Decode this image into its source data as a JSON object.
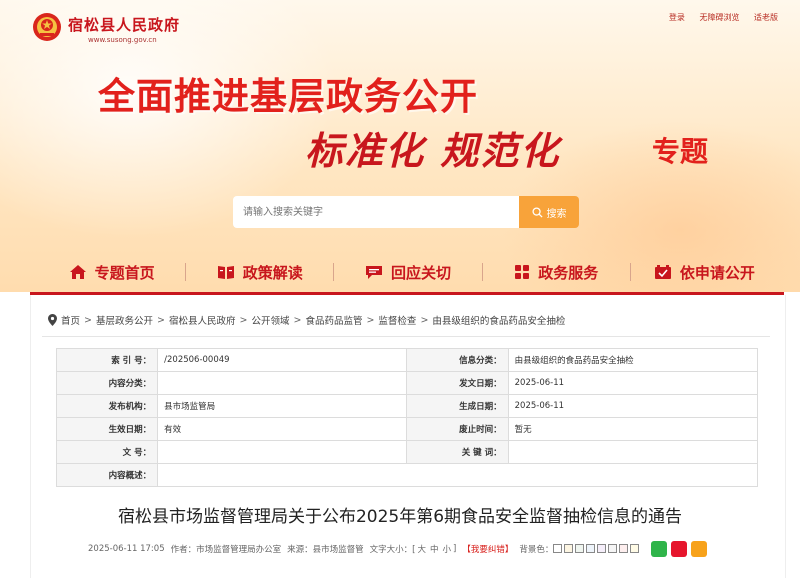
{
  "header": {
    "site_name": "宿松县人民政府",
    "site_url": "www.susong.gov.cn",
    "top_links": [
      "登录",
      "无障碍浏览",
      "适老版"
    ]
  },
  "banner": {
    "line1": "全面推进基层政务公开",
    "line2": "标准化 规范化",
    "line3": "专题"
  },
  "search": {
    "placeholder": "请输入搜索关键字",
    "button_label": "搜索"
  },
  "nav": [
    {
      "label": "专题首页",
      "icon": "home-icon"
    },
    {
      "label": "政策解读",
      "icon": "book-icon"
    },
    {
      "label": "回应关切",
      "icon": "chat-icon"
    },
    {
      "label": "政务服务",
      "icon": "grid-icon"
    },
    {
      "label": "依申请公开",
      "icon": "checkbox-icon"
    }
  ],
  "breadcrumb": [
    "首页",
    "基层政务公开",
    "宿松县人民政府",
    "公开领域",
    "食品药品监管",
    "监督检查",
    "由县级组织的食品药品安全抽检"
  ],
  "info_table": [
    {
      "k1": "索 引 号：",
      "v1": "/202506-00049",
      "k2": "信息分类：",
      "v2": "由县级组织的食品药品安全抽检"
    },
    {
      "k1": "内容分类：",
      "v1": "",
      "k2": "发文日期：",
      "v2": "2025-06-11"
    },
    {
      "k1": "发布机构：",
      "v1": "县市场监管局",
      "k2": "生成日期：",
      "v2": "2025-06-11"
    },
    {
      "k1": "生效日期：",
      "v1": "有效",
      "k2": "废止时间：",
      "v2": "暂无"
    },
    {
      "k1": "文 号：",
      "v1": "",
      "k2": "关 键 词：",
      "v2": ""
    },
    {
      "k1": "内容概述：",
      "v1": "",
      "k2": "",
      "v2": ""
    }
  ],
  "article": {
    "title": "宿松县市场监督管理局关于公布2025年第6期食品安全监督抽检信息的通告",
    "date": "2025-06-11 17:05",
    "author": "作者：市场监督管理局办公室",
    "source": "来源：县市场监督管",
    "font_size_label": "文字大小：[",
    "font_sizes": [
      "大",
      "中",
      "小"
    ],
    "font_size_end": "]",
    "error_report": "【我要纠错】",
    "bg_color_label": "背景色：",
    "bg_colors": [
      "#ffffff",
      "#fdf6e3",
      "#f0f6f0",
      "#eef4fb",
      "#f5eefa",
      "#f5f5f5",
      "#fdeeee",
      "#fffbe6"
    ],
    "share_icons": [
      {
        "name": "wechat-share-icon",
        "color": "#2fb44a"
      },
      {
        "name": "weibo-share-icon",
        "color": "#e6162d"
      },
      {
        "name": "qzone-share-icon",
        "color": "#f7a21b"
      }
    ]
  },
  "colors": {
    "brand_red": "#c8161d",
    "accent_orange": "#f8a33a"
  }
}
